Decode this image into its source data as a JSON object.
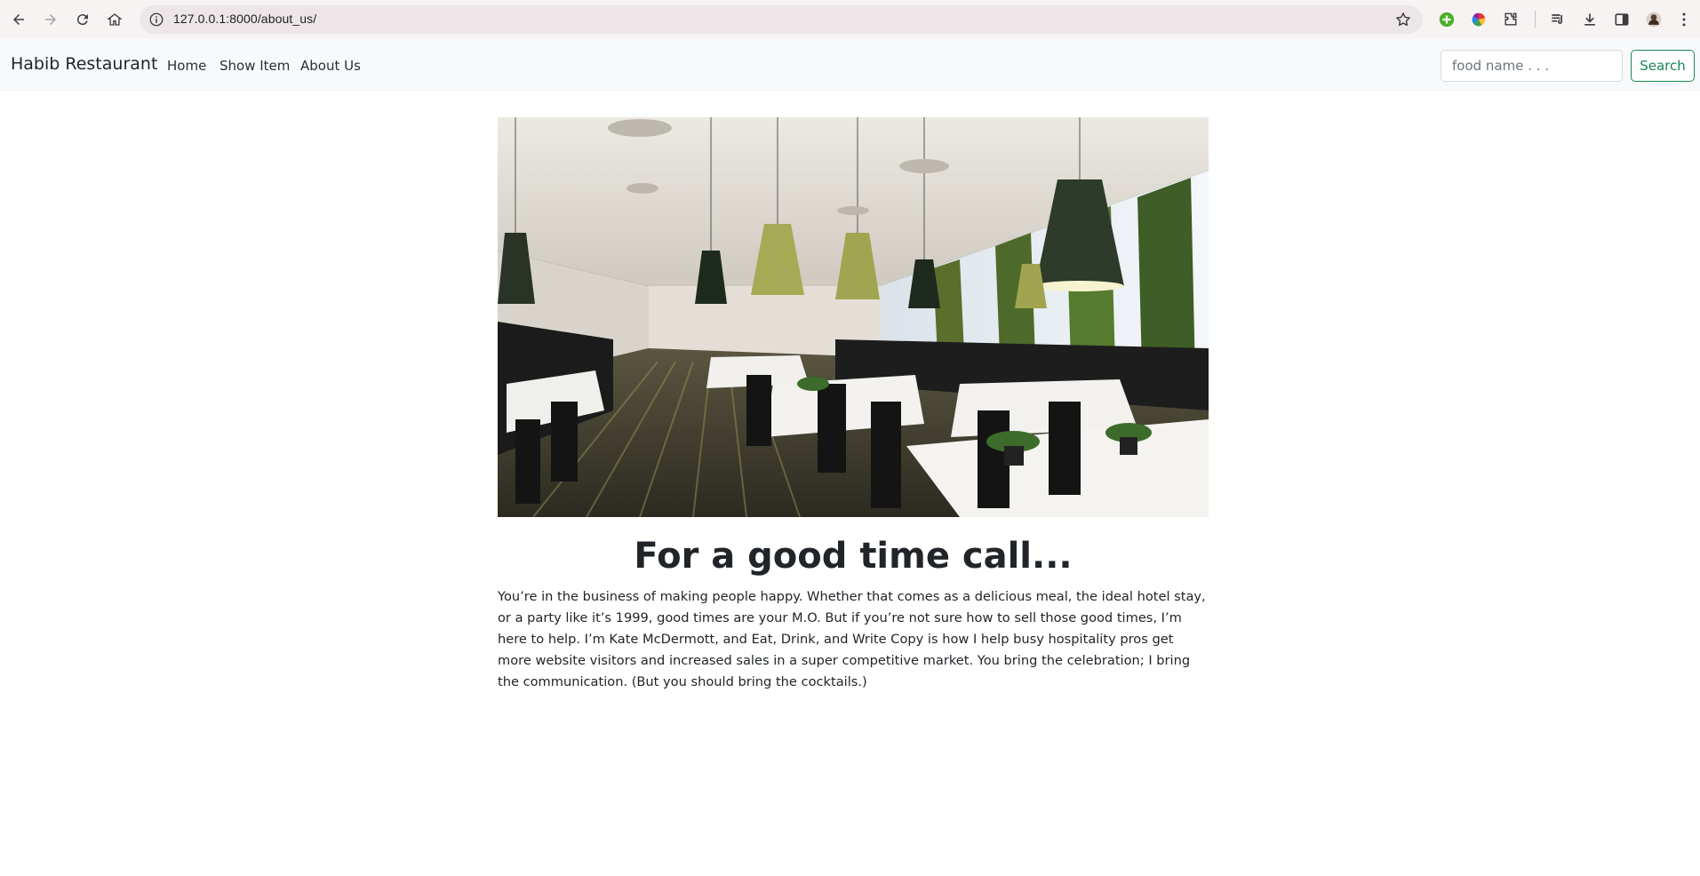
{
  "browser": {
    "url": "127.0.0.1:8000/about_us/"
  },
  "navbar": {
    "brand": "Habib Restaurant",
    "links": [
      {
        "label": "Home"
      },
      {
        "label": "Show Item"
      },
      {
        "label": "About Us"
      }
    ],
    "search": {
      "placeholder": "food name . . .",
      "button_label": "Search"
    }
  },
  "main": {
    "headline": "For a good time call...",
    "paragraph": "You’re in the business of making people happy. Whether that comes as a delicious meal, the ideal hotel stay, or a party like it’s 1999, good times are your M.O. But if you’re not sure how to sell those good times, I’m here to help. I’m Kate McDermott, and Eat, Drink, and Write Copy is how I help busy hospitality pros get more website visitors and increased sales in a super competitive market. You bring the celebration; I bring the communication. (But you should bring the cocktails.)"
  },
  "colors": {
    "navbar_bg": "#f8f9fa",
    "search_accent": "#198754",
    "browser_bg": "#f7f3f3"
  },
  "icons": {
    "back": "back-arrow-icon",
    "forward": "forward-arrow-icon",
    "reload": "reload-icon",
    "home": "home-icon",
    "info": "site-info-icon",
    "bookmark": "star-icon",
    "extensions": [
      "green-plus-extension-icon",
      "color-wheel-extension-icon",
      "puzzle-extensions-icon"
    ],
    "toolbar": [
      "media-controls-icon",
      "download-icon",
      "side-panel-icon",
      "profile-avatar-icon",
      "more-menu-icon"
    ]
  }
}
